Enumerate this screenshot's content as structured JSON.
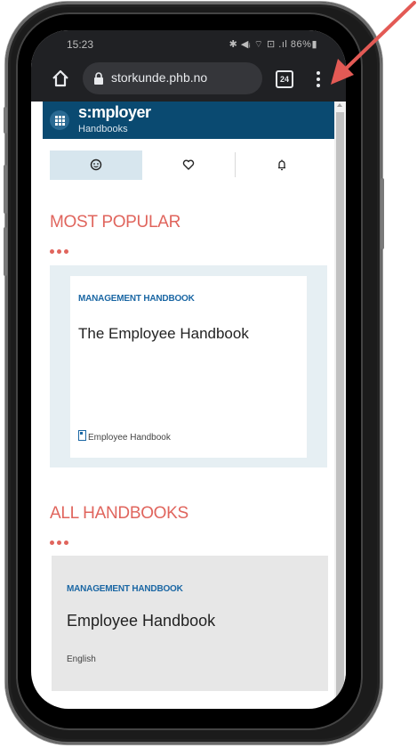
{
  "status_bar": {
    "time": "15:23",
    "indicators": "✱ ◀ᵢ ⌔ ⊡ .ıl 86%▮"
  },
  "browser": {
    "url": "storkunde.phb.no",
    "tab_count": "24",
    "icons": {
      "home": "home-icon",
      "lock": "lock-icon",
      "menu": "more-vertical-icon"
    }
  },
  "app": {
    "brand": "s:mployer",
    "subtitle": "Handbooks"
  },
  "tabs": [
    {
      "icon": "smiley-icon",
      "active": true
    },
    {
      "icon": "heart-icon",
      "active": false
    },
    {
      "icon": "bell-icon",
      "active": false
    }
  ],
  "most_popular": {
    "title": "MOST POPULAR",
    "card": {
      "category": "MANAGEMENT HANDBOOK",
      "title": "The Employee Handbook",
      "footer": "Employee Handbook"
    }
  },
  "all_handbooks": {
    "title": "ALL HANDBOOKS",
    "card": {
      "category": "MANAGEMENT HANDBOOK",
      "title": "Employee Handbook",
      "language": "English"
    }
  },
  "colors": {
    "header_bg": "#0a4a71",
    "accent_red": "#e0655d",
    "category_blue": "#1b67a4",
    "annotation_arrow": "#e35a55"
  }
}
